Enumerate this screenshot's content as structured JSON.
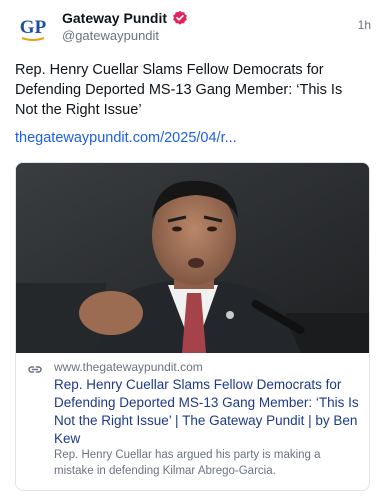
{
  "post": {
    "author_name": "Gateway Pundit",
    "author_handle": "@gatewaypundit",
    "avatar_text": "GP",
    "timestamp": "1h",
    "text": "Rep. Henry Cuellar Slams Fellow Democrats for Defending Deported MS-13 Gang Member: ‘This Is Not the Right Issue’",
    "link_text": "thegatewaypundit.com/2025/04/r..."
  },
  "card": {
    "domain": "www.thegatewaypundit.com",
    "title": "Rep. Henry Cuellar Slams Fellow Democrats for Defending Deported MS-13 Gang Member: ‘This Is Not the Right Issue’ | The Gateway Pundit | by Ben Kew",
    "description": "Rep. Henry Cuellar has argued his party is making a mistake in defending Kilmar Abrego-Garcia.",
    "link_icon": "link-icon"
  },
  "colors": {
    "link_blue": "#1d5ee8",
    "card_title_blue": "#1d3a8a",
    "verified_red": "#e0245e",
    "muted_gray": "#6b7280"
  }
}
